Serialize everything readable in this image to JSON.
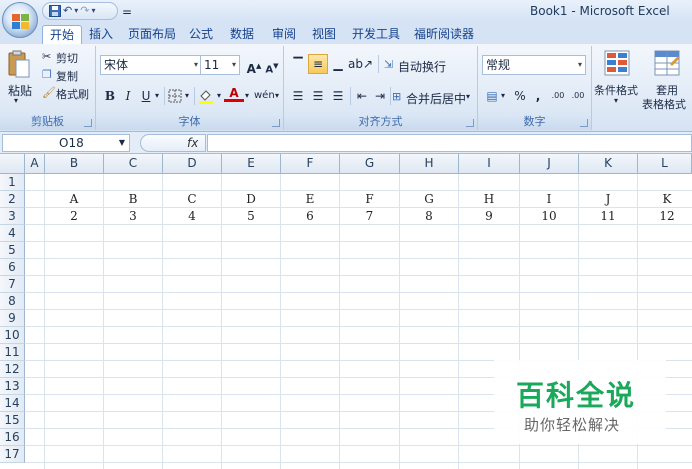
{
  "window": {
    "title": "Book1 - Microsoft Excel"
  },
  "qat": {
    "undo": "↶",
    "redo": "↷",
    "customize": "="
  },
  "tabs": [
    "开始",
    "插入",
    "页面布局",
    "公式",
    "数据",
    "审阅",
    "视图",
    "开发工具",
    "福昕阅读器"
  ],
  "ribbon": {
    "clipboard": {
      "label": "剪贴板",
      "paste": "粘贴",
      "cut": "剪切",
      "copy": "复制",
      "format_painter": "格式刷"
    },
    "font": {
      "label": "字体",
      "name": "宋体",
      "size": "11",
      "grow": "A",
      "shrink": "A",
      "bold": "B",
      "italic": "I",
      "underline": "U",
      "wen": "wén"
    },
    "alignment": {
      "label": "对齐方式",
      "wrap": "自动换行",
      "merge": "合并后居中"
    },
    "number": {
      "label": "数字",
      "format": "常规",
      "percent": "%",
      "comma": ",",
      "inc_decimal": ".00",
      "dec_decimal": ".00"
    },
    "styles": {
      "conditional": "条件格式",
      "table_1": "套用",
      "table_2": "表格格式"
    }
  },
  "formula_bar": {
    "name_box": "O18",
    "fx": "fx",
    "value": ""
  },
  "columns": [
    "A",
    "B",
    "C",
    "D",
    "E",
    "F",
    "G",
    "H",
    "I",
    "J",
    "K",
    "L"
  ],
  "rows": [
    "1",
    "2",
    "3",
    "4",
    "5",
    "6",
    "7",
    "8",
    "9",
    "10",
    "11",
    "12",
    "13",
    "14",
    "15",
    "16",
    "17"
  ],
  "cells": {
    "row2": [
      "A",
      "B",
      "C",
      "D",
      "E",
      "F",
      "G",
      "H",
      "I",
      "J",
      "K"
    ],
    "row3": [
      "2",
      "3",
      "4",
      "5",
      "6",
      "7",
      "8",
      "9",
      "10",
      "11",
      "12"
    ]
  },
  "watermark": {
    "title": "百科全说",
    "subtitle": "助你轻松解决"
  },
  "colors": {
    "accent": "#15428b",
    "watermark": "#1aa85a"
  }
}
